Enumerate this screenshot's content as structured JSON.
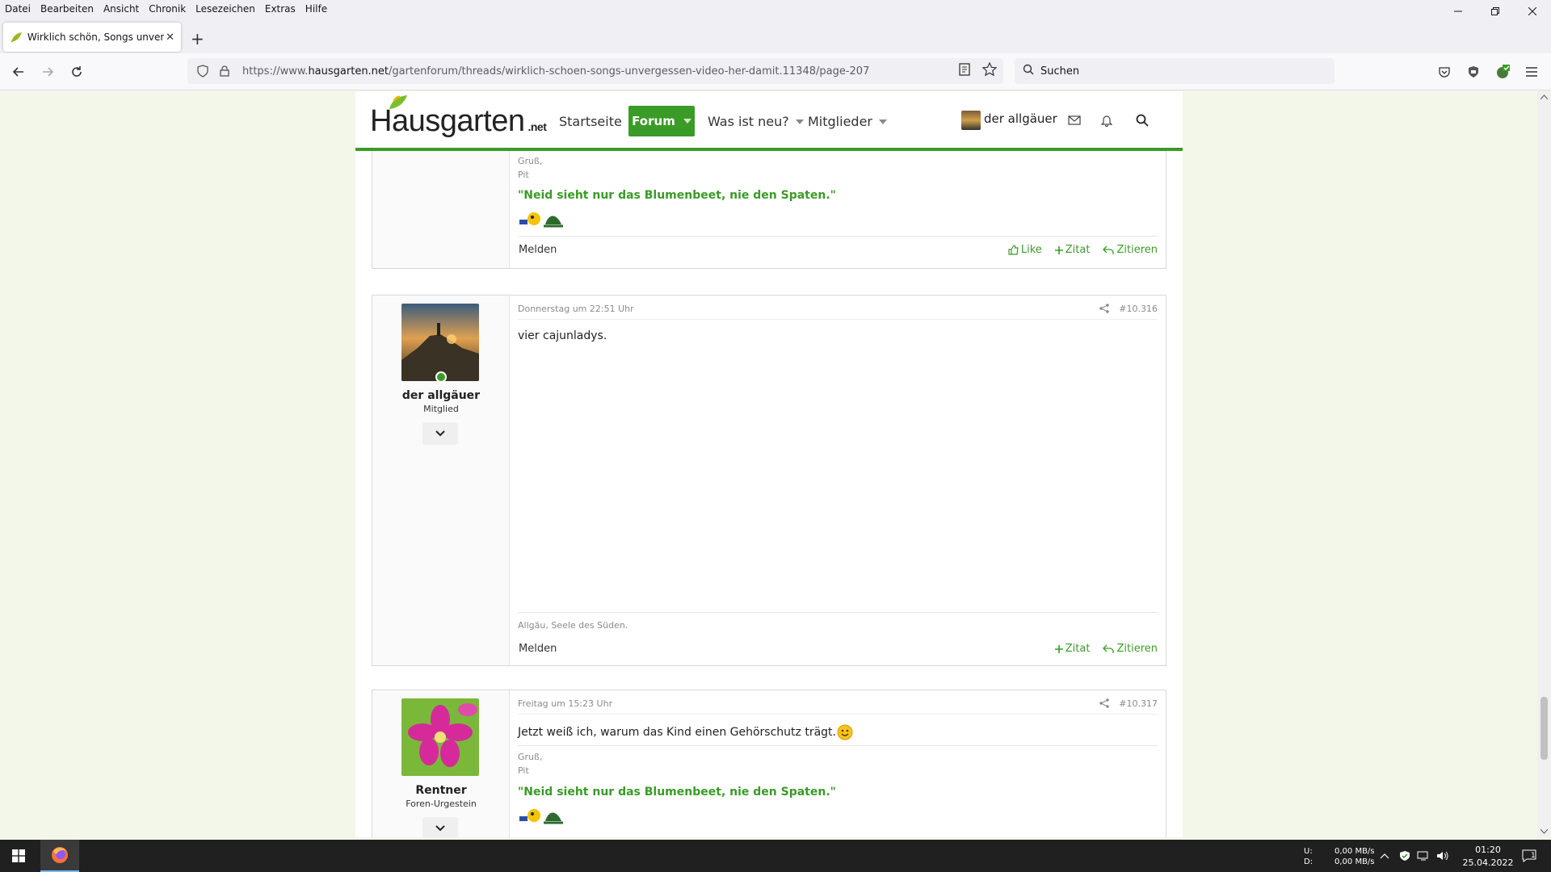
{
  "menubar": {
    "items": [
      "Datei",
      "Bearbeiten",
      "Ansicht",
      "Chronik",
      "Lesezeichen",
      "Extras",
      "Hilfe"
    ]
  },
  "tab": {
    "title": "Wirklich schön, Songs unvergessen"
  },
  "address": {
    "url_prefix": "https://www.",
    "url_domain": "hausgarten.net",
    "url_path": "/gartenforum/threads/wirklich-schoen-songs-unvergessen-video-her-damit.11348/page-207"
  },
  "search": {
    "placeholder": "Suchen"
  },
  "site": {
    "logo_main": "Hausgarten",
    "logo_suffix": ".net",
    "nav": {
      "home": "Startseite",
      "forum": "Forum",
      "whats_new": "Was ist neu?",
      "members": "Mitglieder"
    },
    "user": "der allgäuer"
  },
  "post_prev": {
    "greeting_cut": "Gruß,",
    "sig_name": "Pit",
    "quote": "\"Neid sieht nur das Blumenbeet, nie den Spaten.\"",
    "report": "Melden",
    "like": "Like",
    "zitat": "Zitat",
    "zitieren": "Zitieren"
  },
  "post_1": {
    "author": "der allgäuer",
    "role": "Mitglied",
    "date": "Donnerstag um 22:51 Uhr",
    "number": "#10.316",
    "body": "vier cajunladys.",
    "signature": "Allgäu, Seele des Süden.",
    "report": "Melden",
    "zitat": "Zitat",
    "zitieren": "Zitieren"
  },
  "post_2": {
    "author": "Rentner",
    "role": "Foren-Urgestein",
    "date": "Freitag um 15:23 Uhr",
    "number": "#10.317",
    "body": "Jetzt weiß ich, warum das Kind einen Gehörschutz trägt.",
    "sig_line1": "Gruß,",
    "sig_line2": "Pit",
    "quote": "\"Neid sieht nur das Blumenbeet, nie den Spaten.\""
  },
  "taskbar": {
    "net_up_label": "U:",
    "net_down_label": "D:",
    "net_up": "0,00 MB/s",
    "net_down": "0,00 MB/s",
    "time": "01:20",
    "date": "25.04.2022",
    "notifications": "1"
  },
  "colors": {
    "accent": "#3a9b27",
    "page_bg": "#f2f7ea"
  }
}
